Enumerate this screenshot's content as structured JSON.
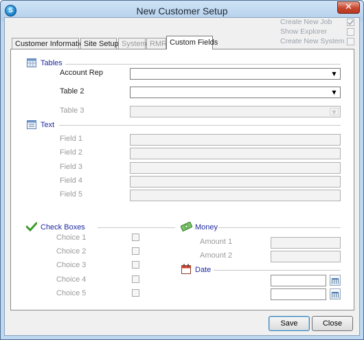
{
  "window": {
    "title": "New Customer Setup",
    "close_glyph": "✕",
    "app_icon_letter": "S"
  },
  "options": [
    {
      "label": "Create New Job",
      "checked": true
    },
    {
      "label": "Show Explorer",
      "checked": false
    },
    {
      "label": "Create New System",
      "checked": false
    }
  ],
  "tabs": [
    {
      "label": "Customer Information",
      "state": "normal"
    },
    {
      "label": "Site Setup",
      "state": "normal"
    },
    {
      "label": "System",
      "state": "disabled"
    },
    {
      "label": "RMR",
      "state": "disabled"
    },
    {
      "label": "Custom Fields",
      "state": "active"
    }
  ],
  "tables": {
    "header": "Tables",
    "icon": "table-icon",
    "rows": [
      {
        "label": "Account Rep",
        "value": "",
        "enabled": true
      },
      {
        "label": "Table 2",
        "value": "",
        "enabled": true
      },
      {
        "label": "Table 3",
        "value": "",
        "enabled": false
      }
    ]
  },
  "text": {
    "header": "Text",
    "icon": "text-form-icon",
    "fields": [
      {
        "label": "Field 1",
        "value": ""
      },
      {
        "label": "Field 2",
        "value": ""
      },
      {
        "label": "Field 3",
        "value": ""
      },
      {
        "label": "Field 4",
        "value": ""
      },
      {
        "label": "Field 5",
        "value": ""
      }
    ]
  },
  "checkboxes": {
    "header": "Check Boxes",
    "icon": "checkmark-icon",
    "items": [
      {
        "label": "Choice 1",
        "checked": false
      },
      {
        "label": "Choice 2",
        "checked": false
      },
      {
        "label": "Choice 3",
        "checked": false
      },
      {
        "label": "Choice 4",
        "checked": false
      },
      {
        "label": "Choice 5",
        "checked": false
      }
    ]
  },
  "money": {
    "header": "Money",
    "icon": "money-icon",
    "fields": [
      {
        "label": "Amount 1",
        "value": ""
      },
      {
        "label": "Amount 2",
        "value": ""
      }
    ]
  },
  "date": {
    "header": "Date",
    "icon": "calendar-icon",
    "fields": [
      {
        "value": ""
      },
      {
        "value": ""
      }
    ]
  },
  "buttons": {
    "save": "Save",
    "close": "Close"
  },
  "colors": {
    "section_header": "#1f2a9e",
    "window_frame": "#bcd7ef",
    "disabled_text": "#9a9a9a"
  }
}
